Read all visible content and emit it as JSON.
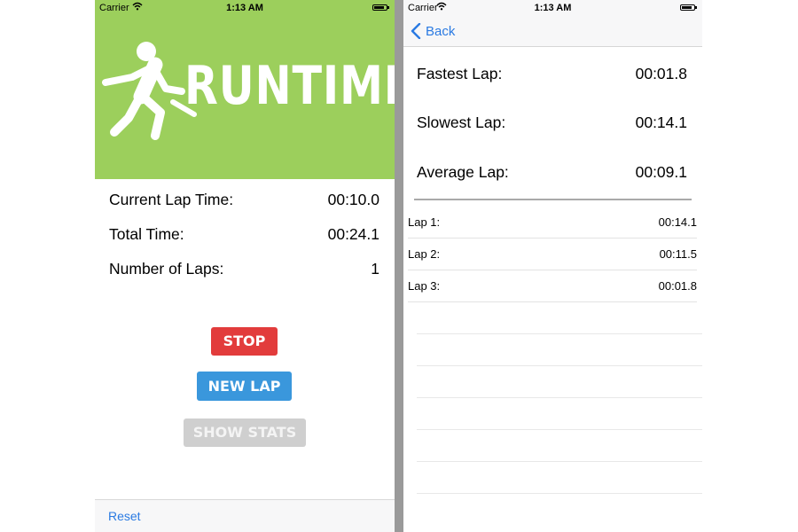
{
  "status_bar": {
    "carrier": "Carrier",
    "time": "1:13 AM"
  },
  "left_screen": {
    "logo_text": "RUNTIME",
    "stats": [
      {
        "label": "Current Lap Time:",
        "value": "00:10.0"
      },
      {
        "label": "Total Time:",
        "value": "00:24.1"
      },
      {
        "label": "Number of Laps:",
        "value": "1"
      }
    ],
    "buttons": {
      "stop": "STOP",
      "new_lap": "NEW LAP",
      "show_stats": "SHOW STATS"
    },
    "toolbar": {
      "reset": "Reset"
    }
  },
  "right_screen": {
    "nav": {
      "back": "Back"
    },
    "summary": [
      {
        "label": "Fastest Lap:",
        "value": "00:01.8"
      },
      {
        "label": "Slowest Lap:",
        "value": "00:14.1"
      },
      {
        "label": "Average Lap:",
        "value": "00:09.1"
      }
    ],
    "laps": [
      {
        "label": "Lap 1:",
        "value": "00:14.1"
      },
      {
        "label": "Lap 2:",
        "value": "00:11.5"
      },
      {
        "label": "Lap 3:",
        "value": "00:01.8"
      }
    ]
  },
  "colors": {
    "banner_green": "#9ccf5c",
    "stop_red": "#e23c3c",
    "new_lap_blue": "#3a97dc",
    "show_stats_gray": "#cfcfcf",
    "ios_blue": "#2a7ae2"
  },
  "icons": [
    "running-man-icon",
    "wifi-icon",
    "battery-icon",
    "chevron-left-icon"
  ]
}
